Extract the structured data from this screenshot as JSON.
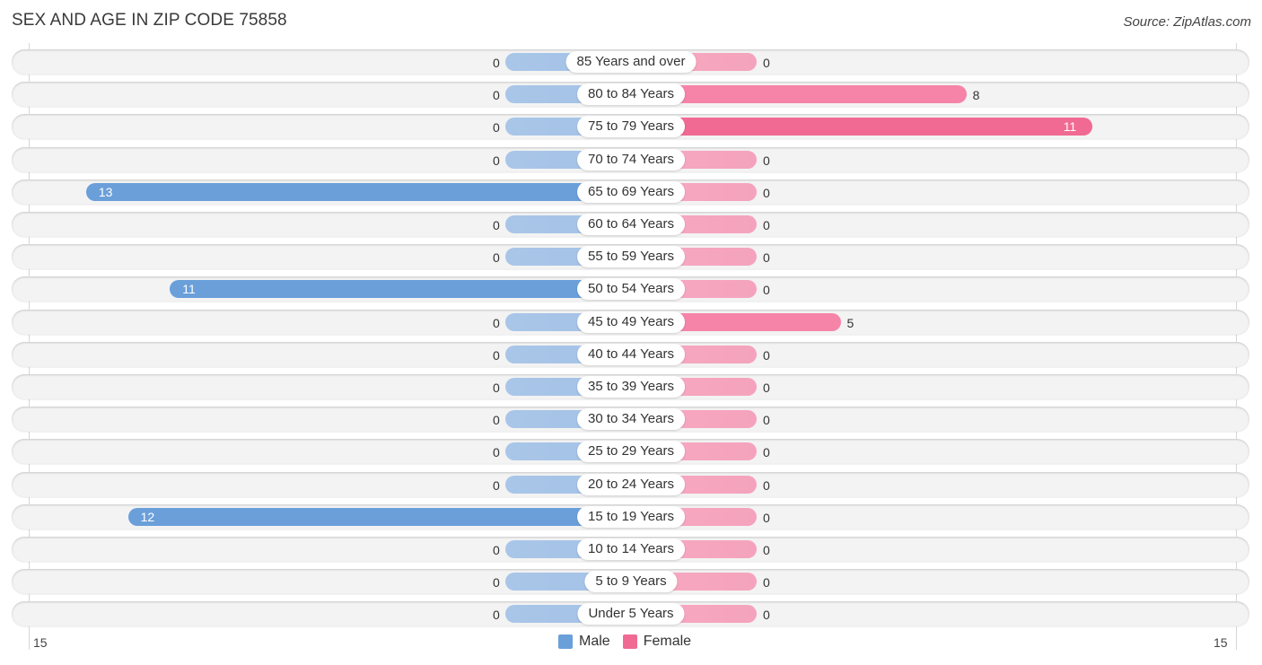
{
  "header": {
    "title": "SEX AND AGE IN ZIP CODE 75858",
    "source": "Source: ZipAtlas.com"
  },
  "colors": {
    "male": "#6a9fda",
    "male_light": "#a9c6e8",
    "female": "#f06a94",
    "female_light": "#f7a9c1"
  },
  "chart_data": {
    "type": "bar",
    "orientation": "horizontal-diverging",
    "title": "SEX AND AGE IN ZIP CODE 75858",
    "categories": [
      "85 Years and over",
      "80 to 84 Years",
      "75 to 79 Years",
      "70 to 74 Years",
      "65 to 69 Years",
      "60 to 64 Years",
      "55 to 59 Years",
      "50 to 54 Years",
      "45 to 49 Years",
      "40 to 44 Years",
      "35 to 39 Years",
      "30 to 34 Years",
      "25 to 29 Years",
      "20 to 24 Years",
      "15 to 19 Years",
      "10 to 14 Years",
      "5 to 9 Years",
      "Under 5 Years"
    ],
    "series": [
      {
        "name": "Male",
        "values": [
          0,
          0,
          0,
          0,
          13,
          0,
          0,
          11,
          0,
          0,
          0,
          0,
          0,
          0,
          12,
          0,
          0,
          0
        ]
      },
      {
        "name": "Female",
        "values": [
          0,
          8,
          11,
          0,
          0,
          0,
          0,
          0,
          5,
          0,
          0,
          0,
          0,
          0,
          0,
          0,
          0,
          0
        ]
      }
    ],
    "axis": {
      "left_tick": "15",
      "right_tick": "15",
      "range": [
        0,
        15
      ]
    },
    "legend": {
      "position": "bottom-center",
      "entries": [
        "Male",
        "Female"
      ]
    },
    "xlabel": "",
    "ylabel": ""
  }
}
